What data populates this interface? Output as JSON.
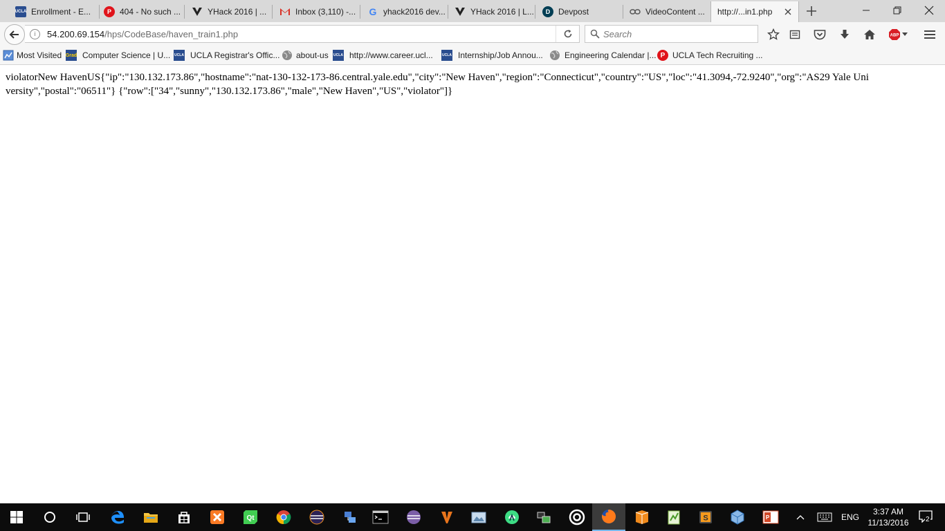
{
  "tabs": [
    {
      "label": "Enrollment - E...",
      "icon": "ucla-icon"
    },
    {
      "label": "404 - No such ...",
      "icon": "p-red-icon"
    },
    {
      "label": "YHack 2016 | ...",
      "icon": "yhack-icon"
    },
    {
      "label": "Inbox (3,110) -...",
      "icon": "gmail-icon"
    },
    {
      "label": "yhack2016 dev...",
      "icon": "google-icon"
    },
    {
      "label": "YHack 2016 | L...",
      "icon": "yhack-icon"
    },
    {
      "label": "Devpost",
      "icon": "devpost-icon"
    },
    {
      "label": "VideoContent ...",
      "icon": "link-icon"
    },
    {
      "label": "http://...in1.php",
      "icon": "none"
    }
  ],
  "url": {
    "host": "54.200.69.154",
    "path": "/hps/CodeBase/haven_train1.php"
  },
  "search": {
    "placeholder": "Search"
  },
  "bookmarks": [
    {
      "label": "Most Visited",
      "icon": "most-visited-icon"
    },
    {
      "label": "Computer Science | U...",
      "icon": "ucla-grad-icon"
    },
    {
      "label": "UCLA Registrar's Offic...",
      "icon": "ucla-icon"
    },
    {
      "label": "about-us",
      "icon": "globe-icon"
    },
    {
      "label": "http://www.career.ucl...",
      "icon": "ucla-icon"
    },
    {
      "label": "Internship/Job Annou...",
      "icon": "ucla-icon"
    },
    {
      "label": "Engineering Calendar |...",
      "icon": "globe-icon"
    },
    {
      "label": "UCLA Tech Recruiting ...",
      "icon": "p-red-icon"
    }
  ],
  "page": {
    "body_text": "violatorNew HavenUS{\"ip\":\"130.132.173.86\",\"hostname\":\"nat-130-132-173-86.central.yale.edu\",\"city\":\"New Haven\",\"region\":\"Connecticut\",\"country\":\"US\",\"loc\":\"41.3094,-72.9240\",\"org\":\"AS29 Yale University\",\"postal\":\"06511\"} {\"row\":[\"34\",\"sunny\",\"130.132.173.86\",\"male\",\"New Haven\",\"US\",\"violator\"]}"
  },
  "abp_label": "ABP",
  "taskbar": {
    "time": "3:37 AM",
    "date": "11/13/2016",
    "language": "ENG",
    "notifications": "2"
  },
  "colors": {
    "accent": "#76b9ed",
    "ucla_blue": "#2a4d8f",
    "red_p": "#e0141b"
  }
}
